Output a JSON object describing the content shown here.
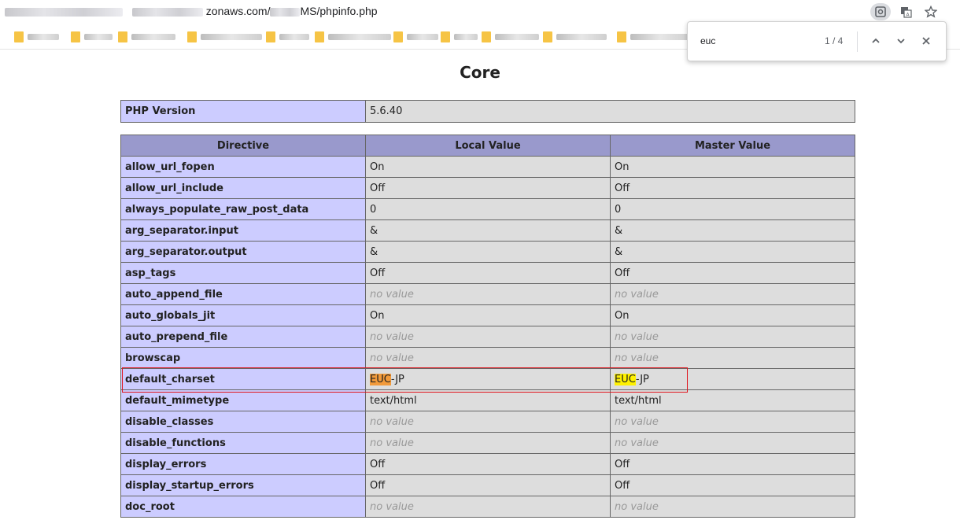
{
  "browser": {
    "url_visible": "zonaws.com/",
    "url_path": "MS/phpinfo.php"
  },
  "find": {
    "query": "euc",
    "count": "1 / 4"
  },
  "page": {
    "section_title": "Core",
    "php_version_label": "PHP Version",
    "php_version_value": "5.6.40",
    "headers": [
      "Directive",
      "Local Value",
      "Master Value"
    ],
    "rows": [
      {
        "directive": "allow_url_fopen",
        "local": "On",
        "master": "On"
      },
      {
        "directive": "allow_url_include",
        "local": "Off",
        "master": "Off"
      },
      {
        "directive": "always_populate_raw_post_data",
        "local": "0",
        "master": "0"
      },
      {
        "directive": "arg_separator.input",
        "local": "&",
        "master": "&"
      },
      {
        "directive": "arg_separator.output",
        "local": "&",
        "master": "&"
      },
      {
        "directive": "asp_tags",
        "local": "Off",
        "master": "Off"
      },
      {
        "directive": "auto_append_file",
        "local": "no value",
        "master": "no value"
      },
      {
        "directive": "auto_globals_jit",
        "local": "On",
        "master": "On"
      },
      {
        "directive": "auto_prepend_file",
        "local": "no value",
        "master": "no value"
      },
      {
        "directive": "browscap",
        "local": "no value",
        "master": "no value"
      },
      {
        "directive": "default_charset",
        "local_match": "EUC",
        "local_rest": "-JP",
        "master_match": "EUC",
        "master_rest": "-JP"
      },
      {
        "directive": "default_mimetype",
        "local": "text/html",
        "master": "text/html"
      },
      {
        "directive": "disable_classes",
        "local": "no value",
        "master": "no value"
      },
      {
        "directive": "disable_functions",
        "local": "no value",
        "master": "no value"
      },
      {
        "directive": "display_errors",
        "local": "Off",
        "master": "Off"
      },
      {
        "directive": "display_startup_errors",
        "local": "Off",
        "master": "Off"
      },
      {
        "directive": "doc_root",
        "local": "no value",
        "master": "no value"
      }
    ]
  },
  "colors": {
    "directive_bg": "#ccccff",
    "value_bg": "#dddddd",
    "header_bg": "#9999cc",
    "current_match": "#f29a3a",
    "other_match": "#fff100",
    "annotation_box": "#e0161e"
  },
  "icons": [
    "lens-icon",
    "translate-icon",
    "star-icon",
    "chevron-up-icon",
    "chevron-down-icon",
    "close-icon",
    "folder-icon"
  ]
}
